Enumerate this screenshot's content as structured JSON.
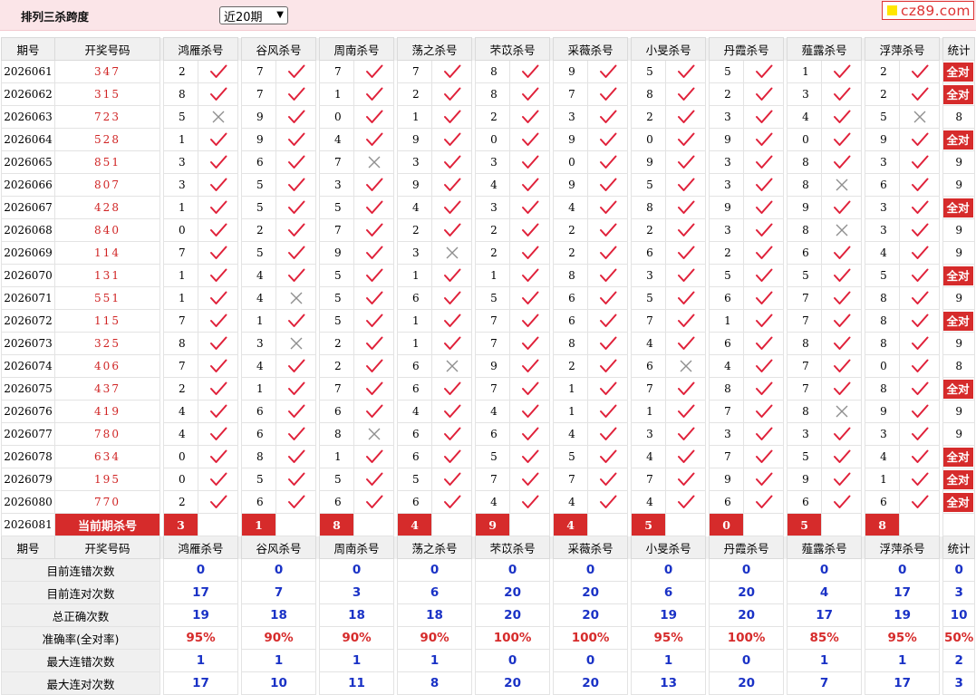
{
  "header": {
    "title": "排列三杀跨度",
    "range_selected": "近20期",
    "logo_text": "cz89.com"
  },
  "columns": {
    "period": "期号",
    "winning": "开奖号码",
    "experts": [
      "鸿雁杀号",
      "谷风杀号",
      "周南杀号",
      "荡之杀号",
      "芣苡杀号",
      "采薇杀号",
      "小旻杀号",
      "丹霞杀号",
      "薤露杀号",
      "浮萍杀号"
    ],
    "stat": "统计"
  },
  "all_right_label": "全对",
  "rows": [
    {
      "period": "2026061",
      "win": "347",
      "kills": [
        2,
        7,
        7,
        7,
        8,
        9,
        5,
        5,
        1,
        2
      ],
      "ok": [
        1,
        1,
        1,
        1,
        1,
        1,
        1,
        1,
        1,
        1
      ],
      "stat": "全对"
    },
    {
      "period": "2026062",
      "win": "315",
      "kills": [
        8,
        7,
        1,
        2,
        8,
        7,
        8,
        2,
        3,
        2
      ],
      "ok": [
        1,
        1,
        1,
        1,
        1,
        1,
        1,
        1,
        1,
        1
      ],
      "stat": "全对"
    },
    {
      "period": "2026063",
      "win": "723",
      "kills": [
        5,
        9,
        0,
        1,
        2,
        3,
        2,
        3,
        4,
        5
      ],
      "ok": [
        0,
        1,
        1,
        1,
        1,
        1,
        1,
        1,
        1,
        0
      ],
      "stat": "8"
    },
    {
      "period": "2026064",
      "win": "528",
      "kills": [
        1,
        9,
        4,
        9,
        0,
        9,
        0,
        9,
        0,
        9
      ],
      "ok": [
        1,
        1,
        1,
        1,
        1,
        1,
        1,
        1,
        1,
        1
      ],
      "stat": "全对"
    },
    {
      "period": "2026065",
      "win": "851",
      "kills": [
        3,
        6,
        7,
        3,
        3,
        0,
        9,
        3,
        8,
        3
      ],
      "ok": [
        1,
        1,
        0,
        1,
        1,
        1,
        1,
        1,
        1,
        1
      ],
      "stat": "9"
    },
    {
      "period": "2026066",
      "win": "807",
      "kills": [
        3,
        5,
        3,
        9,
        4,
        9,
        5,
        3,
        8,
        6
      ],
      "ok": [
        1,
        1,
        1,
        1,
        1,
        1,
        1,
        1,
        0,
        1
      ],
      "stat": "9"
    },
    {
      "period": "2026067",
      "win": "428",
      "kills": [
        1,
        5,
        5,
        4,
        3,
        4,
        8,
        9,
        9,
        3
      ],
      "ok": [
        1,
        1,
        1,
        1,
        1,
        1,
        1,
        1,
        1,
        1
      ],
      "stat": "全对"
    },
    {
      "period": "2026068",
      "win": "840",
      "kills": [
        0,
        2,
        7,
        2,
        2,
        2,
        2,
        3,
        8,
        3
      ],
      "ok": [
        1,
        1,
        1,
        1,
        1,
        1,
        1,
        1,
        0,
        1
      ],
      "stat": "9"
    },
    {
      "period": "2026069",
      "win": "114",
      "kills": [
        7,
        5,
        9,
        3,
        2,
        2,
        6,
        2,
        6,
        4
      ],
      "ok": [
        1,
        1,
        1,
        0,
        1,
        1,
        1,
        1,
        1,
        1
      ],
      "stat": "9"
    },
    {
      "period": "2026070",
      "win": "131",
      "kills": [
        1,
        4,
        5,
        1,
        1,
        8,
        3,
        5,
        5,
        5
      ],
      "ok": [
        1,
        1,
        1,
        1,
        1,
        1,
        1,
        1,
        1,
        1
      ],
      "stat": "全对"
    },
    {
      "period": "2026071",
      "win": "551",
      "kills": [
        1,
        4,
        5,
        6,
        5,
        6,
        5,
        6,
        7,
        8
      ],
      "ok": [
        1,
        0,
        1,
        1,
        1,
        1,
        1,
        1,
        1,
        1
      ],
      "stat": "9"
    },
    {
      "period": "2026072",
      "win": "115",
      "kills": [
        7,
        1,
        5,
        1,
        7,
        6,
        7,
        1,
        7,
        8
      ],
      "ok": [
        1,
        1,
        1,
        1,
        1,
        1,
        1,
        1,
        1,
        1
      ],
      "stat": "全对"
    },
    {
      "period": "2026073",
      "win": "325",
      "kills": [
        8,
        3,
        2,
        1,
        7,
        8,
        4,
        6,
        8,
        8
      ],
      "ok": [
        1,
        0,
        1,
        1,
        1,
        1,
        1,
        1,
        1,
        1
      ],
      "stat": "9"
    },
    {
      "period": "2026074",
      "win": "406",
      "kills": [
        7,
        4,
        2,
        6,
        9,
        2,
        6,
        4,
        7,
        0
      ],
      "ok": [
        1,
        1,
        1,
        0,
        1,
        1,
        0,
        1,
        1,
        1
      ],
      "stat": "8"
    },
    {
      "period": "2026075",
      "win": "437",
      "kills": [
        2,
        1,
        7,
        6,
        7,
        1,
        7,
        8,
        7,
        8
      ],
      "ok": [
        1,
        1,
        1,
        1,
        1,
        1,
        1,
        1,
        1,
        1
      ],
      "stat": "全对"
    },
    {
      "period": "2026076",
      "win": "419",
      "kills": [
        4,
        6,
        6,
        4,
        4,
        1,
        1,
        7,
        8,
        9
      ],
      "ok": [
        1,
        1,
        1,
        1,
        1,
        1,
        1,
        1,
        0,
        1
      ],
      "stat": "9"
    },
    {
      "period": "2026077",
      "win": "780",
      "kills": [
        4,
        6,
        8,
        6,
        6,
        4,
        3,
        3,
        3,
        3
      ],
      "ok": [
        1,
        1,
        0,
        1,
        1,
        1,
        1,
        1,
        1,
        1
      ],
      "stat": "9"
    },
    {
      "period": "2026078",
      "win": "634",
      "kills": [
        0,
        8,
        1,
        6,
        5,
        5,
        4,
        7,
        5,
        4
      ],
      "ok": [
        1,
        1,
        1,
        1,
        1,
        1,
        1,
        1,
        1,
        1
      ],
      "stat": "全对"
    },
    {
      "period": "2026079",
      "win": "195",
      "kills": [
        0,
        5,
        5,
        5,
        7,
        7,
        7,
        9,
        9,
        1
      ],
      "ok": [
        1,
        1,
        1,
        1,
        1,
        1,
        1,
        1,
        1,
        1
      ],
      "stat": "全对"
    },
    {
      "period": "2026080",
      "win": "770",
      "kills": [
        2,
        6,
        6,
        6,
        4,
        4,
        4,
        6,
        6,
        6
      ],
      "ok": [
        1,
        1,
        1,
        1,
        1,
        1,
        1,
        1,
        1,
        1
      ],
      "stat": "全对"
    }
  ],
  "current": {
    "period": "2026081",
    "label": "当前期杀号",
    "kills": [
      3,
      1,
      8,
      4,
      9,
      4,
      5,
      0,
      5,
      8
    ]
  },
  "stats": [
    {
      "label": "目前连错次数",
      "values": [
        "0",
        "0",
        "0",
        "0",
        "0",
        "0",
        "0",
        "0",
        "0",
        "0"
      ],
      "total": "0"
    },
    {
      "label": "目前连对次数",
      "values": [
        "17",
        "7",
        "3",
        "6",
        "20",
        "20",
        "6",
        "20",
        "4",
        "17"
      ],
      "total": "3"
    },
    {
      "label": "总正确次数",
      "values": [
        "19",
        "18",
        "18",
        "18",
        "20",
        "20",
        "19",
        "20",
        "17",
        "19"
      ],
      "total": "10"
    },
    {
      "label": "准确率(全对率)",
      "values": [
        "95%",
        "90%",
        "90%",
        "90%",
        "100%",
        "100%",
        "95%",
        "100%",
        "85%",
        "95%"
      ],
      "total": "50%",
      "pct": true
    },
    {
      "label": "最大连错次数",
      "values": [
        "1",
        "1",
        "1",
        "1",
        "0",
        "0",
        "1",
        "0",
        "1",
        "1"
      ],
      "total": "2"
    },
    {
      "label": "最大连对次数",
      "values": [
        "17",
        "10",
        "11",
        "8",
        "20",
        "20",
        "13",
        "20",
        "7",
        "17"
      ],
      "total": "3"
    }
  ]
}
